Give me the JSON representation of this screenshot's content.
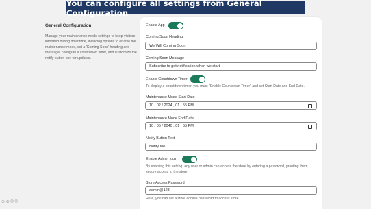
{
  "banner": {
    "text": "You can configure all settings from General Configuration"
  },
  "section": {
    "title": "General Configuration",
    "description": "Manage your maintenance mode settings to keep visitors informed during downtime, including options to enable the maintenance mode, set a 'Coming Soon' heading and message, configure a countdown timer, and customize the notify button text for updates."
  },
  "form": {
    "enable_app": {
      "label": "Enable App",
      "on": true
    },
    "heading": {
      "label": "Coming Soon Heading",
      "value": "We Will Coming Soon"
    },
    "message": {
      "label": "Coming Soon Message",
      "value": "Subscribe to get notification when we start"
    },
    "countdown": {
      "label": "Enable Countdown Timer",
      "on": true,
      "help": "To display a countdown timer, you must \"Enable Countdown Timer\" and set Start Date and End Date."
    },
    "start_date": {
      "label": "Maintenance Mode Start Date",
      "value": "10 / 02 / 2024 ,  01 : 55   PM"
    },
    "end_date": {
      "label": "Maintenance Mode End Date",
      "value": "10 / 05 / 2040 ,  01 : 55   PM"
    },
    "notify": {
      "label": "Notify Button Text",
      "value": "Notify Me"
    },
    "admin_login": {
      "label": "Enable Admin login",
      "on": true,
      "help": "By enabling this setting, any user or admin can access the store by entering a password, granting them secure access to the store."
    },
    "password": {
      "label": "Store Access Password",
      "value": "admin@123",
      "help": "Here, you can set a store access password to access store."
    }
  },
  "footer": {
    "glyphs": "⊙ ⊘ ® ©"
  },
  "colors": {
    "banner": "#1f3864",
    "toggle": "#1a7a5a"
  }
}
